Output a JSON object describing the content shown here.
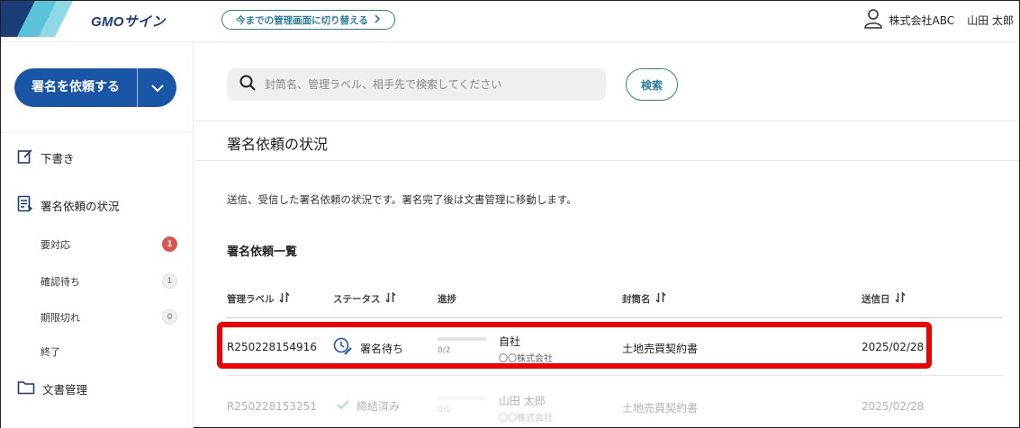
{
  "header": {
    "brand": "GMOサイン",
    "switch_label": "今までの管理画面に切り替える",
    "company": "株式会社ABC",
    "user_name": "山田 太郎"
  },
  "sidebar": {
    "request_button": "署名を依頼する",
    "items": [
      {
        "label": "下書き",
        "icon": "edit-icon"
      },
      {
        "label": "署名依頼の状況",
        "icon": "document-status-icon"
      },
      {
        "label": "文書管理",
        "icon": "folder-icon"
      }
    ],
    "sub_items": [
      {
        "label": "要対応",
        "count": "1"
      },
      {
        "label": "確認待ち",
        "count": "1"
      },
      {
        "label": "期限切れ",
        "count": "0"
      },
      {
        "label": "終了",
        "count": ""
      }
    ]
  },
  "search": {
    "placeholder": "封筒名、管理ラベル、相手先で検索してください",
    "button": "検索"
  },
  "main": {
    "page_title": "署名依頼の状況",
    "description": "送信、受信した署名依頼の状況です。署名完了後は文書管理に移動します。",
    "list_title": "署名依頼一覧",
    "columns": [
      "管理ラベル",
      "ステータス",
      "進捗",
      "封筒名",
      "送信日"
    ],
    "rows": [
      {
        "label": "R250228154916",
        "status": "署名待ち",
        "progress": "0/2",
        "progress_fraction": 0,
        "sender": "自社",
        "sender_company": "〇〇株式会社",
        "envelope": "土地売買契約書",
        "date": "2025/02/28"
      },
      {
        "label": "R250228153251",
        "status": "締結済み",
        "progress": "0/1",
        "progress_fraction": 0,
        "sender": "山田 太郎",
        "sender_company": "〇〇株式会社",
        "envelope": "土地売買契約書",
        "date": "2025/02/28"
      }
    ]
  },
  "colors": {
    "primary": "#1a56a8",
    "accent": "#2d7f9b",
    "badge_red": "#d9534f",
    "highlight": "#ee0000"
  }
}
